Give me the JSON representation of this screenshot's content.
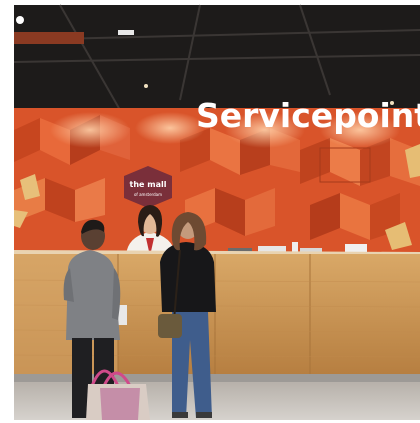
{
  "sign": {
    "text": "Servicepoint"
  },
  "logo": {
    "name": "the mall",
    "sub": "of amsterdam"
  },
  "colors": {
    "wall": "#d9542a",
    "wall_dark": "#b63d1c",
    "wall_light": "#ef8a55",
    "ceiling": "#1c1a19",
    "counter": "#c99557",
    "counter_dark": "#a8743a",
    "floor": "#cfcac4",
    "logo_bg": "#7a2f3a",
    "sign": "#ffffff"
  }
}
